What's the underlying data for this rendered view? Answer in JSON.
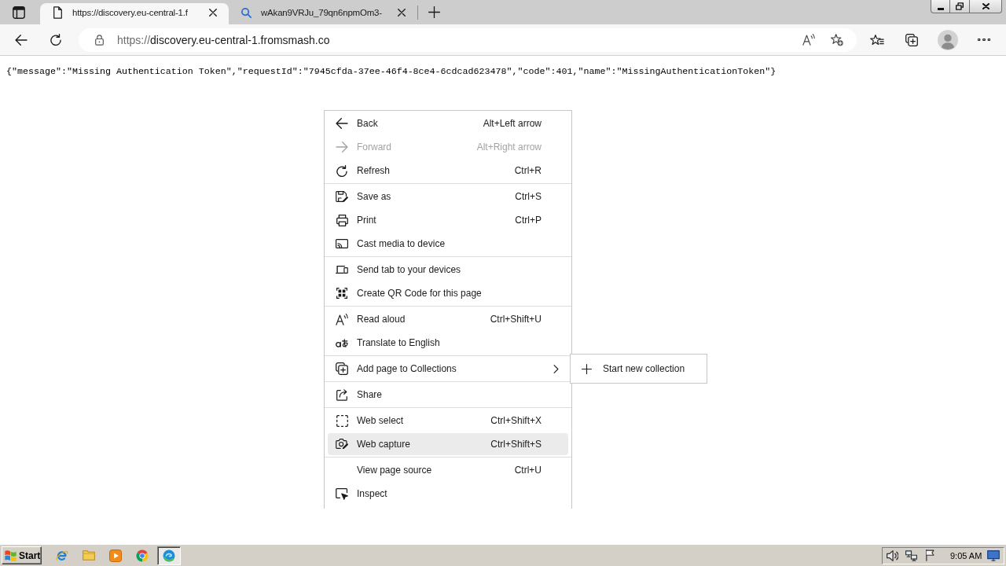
{
  "tabs": [
    {
      "title": "https://discovery.eu-central-1.f",
      "kind": "page",
      "selected": true
    },
    {
      "title": "wAkan9VRJu_79qn6npmOm3-",
      "kind": "search",
      "selected": false
    }
  ],
  "address_bar": {
    "scheme": "https://",
    "host": "discovery.eu-central-1.fromsmash.co"
  },
  "page": {
    "text": "{\"message\":\"Missing Authentication Token\",\"requestId\":\"7945cfda-37ee-46f4-8ce4-6cdcad623478\",\"code\":401,\"name\":\"MissingAuthenticationToken\"}"
  },
  "context_menu": {
    "groups": [
      {
        "items": [
          {
            "label": "Back",
            "shortcut": "Alt+Left arrow",
            "disabled": false,
            "highlighted": false
          },
          {
            "label": "Forward",
            "shortcut": "Alt+Right arrow",
            "disabled": true,
            "highlighted": false
          },
          {
            "label": "Refresh",
            "shortcut": "Ctrl+R",
            "disabled": false,
            "highlighted": false
          }
        ]
      },
      {
        "items": [
          {
            "label": "Save as",
            "shortcut": "Ctrl+S",
            "disabled": false,
            "highlighted": false
          },
          {
            "label": "Print",
            "shortcut": "Ctrl+P",
            "disabled": false,
            "highlighted": false
          },
          {
            "label": "Cast media to device",
            "disabled": false,
            "highlighted": false
          }
        ]
      },
      {
        "items": [
          {
            "label": "Send tab to your devices",
            "disabled": false,
            "highlighted": false
          },
          {
            "label": "Create QR Code for this page",
            "disabled": false,
            "highlighted": false
          }
        ]
      },
      {
        "items": [
          {
            "label": "Read aloud",
            "shortcut": "Ctrl+Shift+U",
            "disabled": false,
            "highlighted": false
          },
          {
            "label": "Translate to English",
            "disabled": false,
            "highlighted": false
          }
        ]
      },
      {
        "items": [
          {
            "label": "Add page to Collections",
            "disabled": false,
            "highlighted": false,
            "submenu": [
              {
                "label": "Start new collection"
              }
            ]
          }
        ]
      },
      {
        "items": [
          {
            "label": "Share",
            "disabled": false,
            "highlighted": false
          }
        ]
      },
      {
        "items": [
          {
            "label": "Web select",
            "shortcut": "Ctrl+Shift+X",
            "disabled": false,
            "highlighted": false
          },
          {
            "label": "Web capture",
            "shortcut": "Ctrl+Shift+S",
            "disabled": false,
            "highlighted": true
          }
        ]
      },
      {
        "items": [
          {
            "label": "View page source",
            "shortcut": "Ctrl+U",
            "disabled": false,
            "highlighted": false
          },
          {
            "label": "Inspect",
            "disabled": false,
            "highlighted": false
          }
        ]
      }
    ]
  },
  "taskbar": {
    "start": "Start",
    "apps": [
      {
        "selected": false
      },
      {
        "selected": false
      },
      {
        "selected": false
      },
      {
        "selected": false
      },
      {
        "selected": true
      }
    ],
    "clock": "9:05 AM"
  }
}
